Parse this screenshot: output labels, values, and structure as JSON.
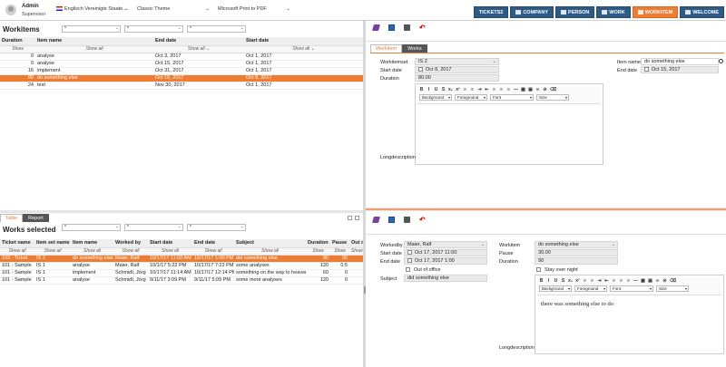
{
  "user": {
    "name": "Admin",
    "role": "Supervisor"
  },
  "top": {
    "language": "Englisch Vereinigte Staate...",
    "theme": "Classic Theme",
    "printer": "Microsoft Print to PDF"
  },
  "nav": [
    {
      "label": "TICKETS2",
      "icon": "",
      "active": false
    },
    {
      "label": "COMPANY",
      "icon": "company-icon",
      "active": false
    },
    {
      "label": "PERSON",
      "icon": "person-icon",
      "active": false
    },
    {
      "label": "WORK",
      "icon": "work-icon",
      "active": false
    },
    {
      "label": "WORKITEM",
      "icon": "workitem-icon",
      "active": true
    },
    {
      "label": "WELCOME",
      "icon": "welcome-icon",
      "active": false
    }
  ],
  "workitems": {
    "title": "Workitems",
    "filters": [
      "*",
      "*",
      "*"
    ],
    "columns": [
      "Duration",
      "Item name",
      "End date",
      "Start date"
    ],
    "filter_row": [
      "Show",
      "Show all",
      "Show all",
      "Show all"
    ],
    "rows": [
      [
        "0",
        "analyse",
        "Oct 3, 2017",
        "Oct 1, 2017"
      ],
      [
        "0",
        "analyse",
        "Oct 15, 2017",
        "Oct 1, 2017"
      ],
      [
        "16",
        "implement",
        "Oct 31, 2017",
        "Oct 1, 2017"
      ],
      [
        "80",
        "do something else",
        "Oct 15, 2017",
        "Oct 8, 2017"
      ],
      [
        "24",
        "test",
        "Nov 30, 2017",
        "Oct 1, 2017"
      ]
    ],
    "selected_row": 3
  },
  "works": {
    "tabs": [
      "Table",
      "Report"
    ],
    "title": "Works selected",
    "filters": [
      "*",
      "*",
      "*"
    ],
    "columns": [
      "Ticket name",
      "Item set name",
      "Item name",
      "Worked by",
      "Start date",
      "End date",
      "Subject",
      "Duration",
      "Pause",
      "Out o"
    ],
    "filter_row": [
      "Show all",
      "Show all",
      "Show all",
      "Show all",
      "Show all",
      "Show all",
      "Show all",
      "Show",
      "Show",
      "Show"
    ],
    "rows": [
      [
        "102 - Ticket",
        "IS 2",
        "do something else",
        "Maier, Ralf",
        "10/17/17 11:00 AM",
        "10/17/17 1:00 PM",
        "did something else",
        "90",
        "30",
        ""
      ],
      [
        "101 - Sample",
        "IS 1",
        "analyse",
        "Maier, Ralf",
        "10/1/17 5:22 PM",
        "10/17/17 7:22 PM",
        "some analyses",
        "120",
        "0.5",
        ""
      ],
      [
        "101 - Sample",
        "IS 1",
        "implement",
        "Schmidt, Jörg",
        "10/17/17 11:14 AM",
        "10/17/17 12:14 PM",
        "something on the way to heaven",
        "60",
        "0",
        ""
      ],
      [
        "101 - Sample",
        "IS 1",
        "analyse",
        "Schmidt, Jörg",
        "9/11/17 3:09 PM",
        "9/11/17 5:09 PM",
        "some more analyses",
        "120",
        "0",
        ""
      ]
    ],
    "selected_row": 0
  },
  "workitem_form": {
    "tabs": [
      "Workitem",
      "Works"
    ],
    "workitemset_label": "Workitemset",
    "workitemset_value": "IS 2",
    "start_label": "Start date",
    "start_value": "Oct 8, 2017",
    "duration_label": "Duration",
    "duration_value": "80.00",
    "item_name_label": "Item name",
    "item_name_value": "do something else",
    "end_label": "End date",
    "end_value": "Oct 15, 2017",
    "longdesc_label": "Longdescription",
    "editor": {
      "background": "Background",
      "foreground": "Foreground",
      "font": "Font",
      "size": "Size"
    }
  },
  "work_form": {
    "workedby_label": "Workedby",
    "workedby_value": "Maier, Ralf",
    "start_label": "Start date",
    "start_value": "Oct 17, 2017 11:00",
    "end_label": "End date",
    "end_value": "Oct 17, 2017 1:00",
    "out_of_office": "Out of office",
    "subject_label": "Subject",
    "subject_value": "did something else",
    "workitem_label": "Workitem",
    "workitem_value": "do something else",
    "pause_label": "Pause",
    "pause_value": "30.00",
    "duration_label": "Duration",
    "duration_value": "90",
    "stay_over_night": "Stay over night",
    "longdesc_label": "Longdescription",
    "longdesc_text": "there was something else to do",
    "editor": {
      "background": "Background",
      "foreground": "Foreground",
      "font": "Font",
      "size": "Size"
    }
  },
  "colors": {
    "accent": "#ee7d33",
    "nav": "#2e5a86"
  }
}
